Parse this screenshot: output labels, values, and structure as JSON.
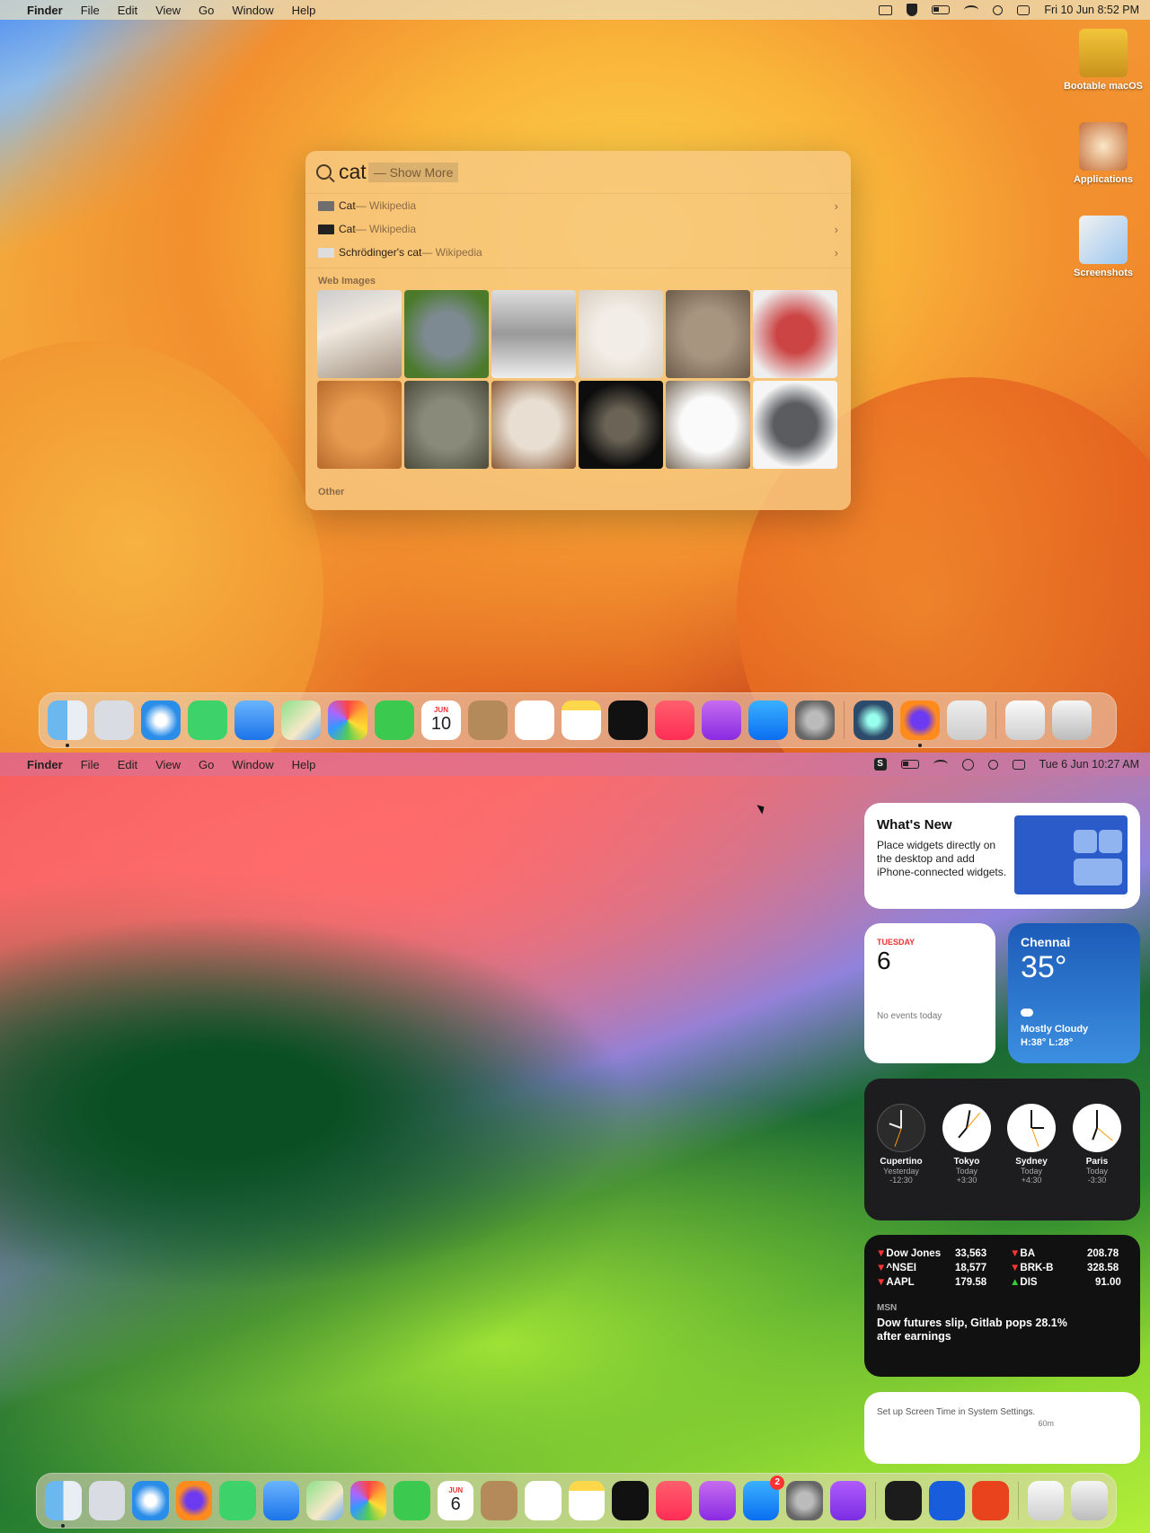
{
  "top": {
    "menubar": {
      "app": "Finder",
      "items": [
        "File",
        "Edit",
        "View",
        "Go",
        "Window",
        "Help"
      ],
      "datetime": "Fri 10 Jun  8:52 PM"
    },
    "desktop_icons": [
      {
        "label": "Bootable macOS",
        "icon": "hard-drive-icon"
      },
      {
        "label": "Applications",
        "icon": "applications-folder-icon"
      },
      {
        "label": "Screenshots",
        "icon": "screenshots-folder-icon"
      }
    ],
    "spotlight": {
      "query": "cat",
      "hint": "— Show More",
      "results": [
        {
          "title": "Cat",
          "source": " — Wikipedia"
        },
        {
          "title": "Cat",
          "source": " — Wikipedia"
        },
        {
          "title": "Schrödinger's cat",
          "source": " — Wikipedia"
        }
      ],
      "section_web_images": "Web Images",
      "section_other": "Other",
      "image_count": 12
    },
    "dock": {
      "apps": [
        "Finder",
        "Launchpad",
        "Safari",
        "Messages",
        "Mail",
        "Maps",
        "Photos",
        "FaceTime",
        "Calendar",
        "Contacts",
        "Reminders",
        "Notes",
        "TV",
        "Music",
        "Podcasts",
        "App Store",
        "System Settings",
        "QuickTime",
        "Firefox",
        "AdGuard",
        "Downloads",
        "Trash"
      ],
      "calendar_month": "JUN",
      "calendar_day": "10"
    }
  },
  "bottom": {
    "menubar": {
      "app": "Finder",
      "items": [
        "File",
        "Edit",
        "View",
        "Go",
        "Window",
        "Help"
      ],
      "datetime": "Tue 6 Jun  10:27 AM"
    },
    "widgets": {
      "whats_new": {
        "title": "What's New",
        "description": "Place widgets directly on the desktop and add iPhone-connected widgets."
      },
      "calendar": {
        "weekday": "TUESDAY",
        "day": "6",
        "events": "No events today"
      },
      "weather": {
        "city": "Chennai",
        "temp": "35°",
        "condition": "Mostly Cloudy",
        "range": "H:38° L:28°"
      },
      "world_clock": [
        {
          "city": "Cupertino",
          "when": "Yesterday",
          "offset": "-12:30"
        },
        {
          "city": "Tokyo",
          "when": "Today",
          "offset": "+3:30"
        },
        {
          "city": "Sydney",
          "when": "Today",
          "offset": "+4:30"
        },
        {
          "city": "Paris",
          "when": "Today",
          "offset": "-3:30"
        }
      ],
      "stocks": {
        "left": [
          {
            "symbol": "Dow Jones",
            "value": "33,563",
            "dir": "down"
          },
          {
            "symbol": "^NSEI",
            "value": "18,577",
            "dir": "down"
          },
          {
            "symbol": "AAPL",
            "value": "179.58",
            "dir": "down"
          }
        ],
        "right": [
          {
            "symbol": "BA",
            "value": "208.78",
            "dir": "down"
          },
          {
            "symbol": "BRK-B",
            "value": "328.58",
            "dir": "down"
          },
          {
            "symbol": "DIS",
            "value": "91.00",
            "dir": "up"
          }
        ],
        "news_source": "MSN",
        "headline": "Dow futures slip, Gitlab pops 28.1% after earnings"
      },
      "screen_time": {
        "text": "Set up Screen Time in System Settings.",
        "axis": "60m"
      }
    },
    "dock": {
      "apps": [
        "Finder",
        "Launchpad",
        "Safari",
        "Firefox",
        "Messages",
        "Mail",
        "Maps",
        "Photos",
        "FaceTime",
        "Calendar",
        "Contacts",
        "Reminders",
        "Notes",
        "TV",
        "Music",
        "Podcasts",
        "App Store",
        "System Settings",
        "Feedback Assistant",
        "Terminal",
        "Bitwarden",
        "Scrivener",
        "Downloads",
        "Trash"
      ],
      "calendar_month": "JUN",
      "calendar_day": "6",
      "appstore_badge": "2"
    }
  }
}
